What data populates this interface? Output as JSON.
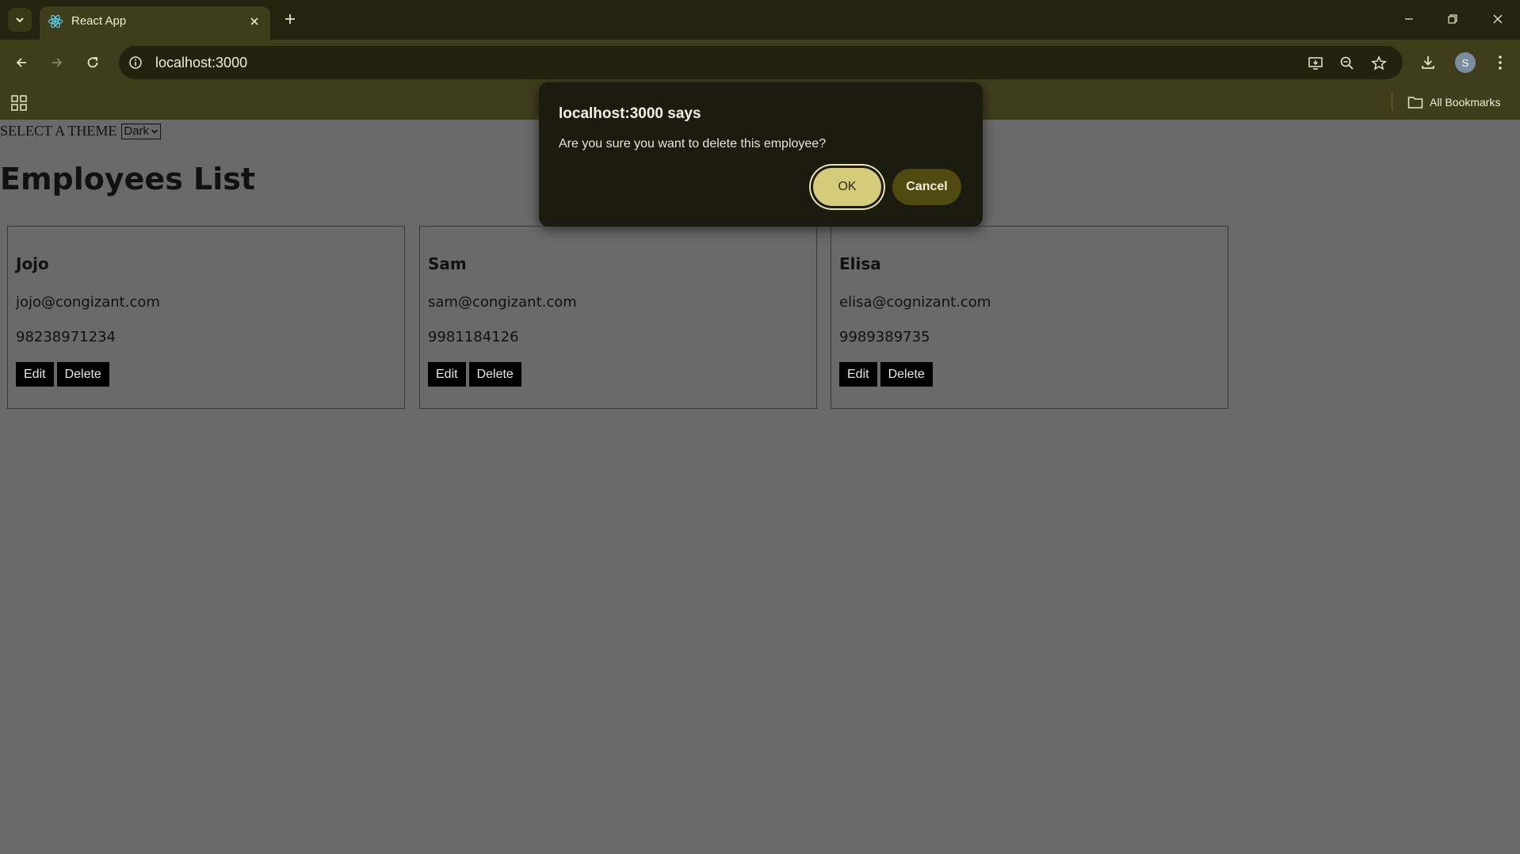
{
  "browser": {
    "tab_title": "React App",
    "url": "localhost:3000",
    "profile_initial": "S",
    "bookmarks_label": "All Bookmarks"
  },
  "page": {
    "theme_label": "SELECT A THEME",
    "theme_value": "Dark",
    "title": "Employees List",
    "employees": [
      {
        "name": "Jojo",
        "email": "jojo@congizant.com",
        "phone": "98238971234"
      },
      {
        "name": "Sam",
        "email": "sam@congizant.com",
        "phone": "9981184126"
      },
      {
        "name": "Elisa",
        "email": "elisa@cognizant.com",
        "phone": "9989389735"
      }
    ],
    "edit_label": "Edit",
    "delete_label": "Delete"
  },
  "dialog": {
    "title": "localhost:3000 says",
    "message": "Are you sure you want to delete this employee?",
    "ok_label": "OK",
    "cancel_label": "Cancel"
  },
  "colors": {
    "chrome_bg": "#3f3d1c",
    "tabstrip_bg": "#25230f",
    "page_overlay": "#6a6a6a",
    "dialog_bg": "#1c1b10",
    "ok_button": "#d4cc7a",
    "cancel_button": "#4e4a10"
  }
}
